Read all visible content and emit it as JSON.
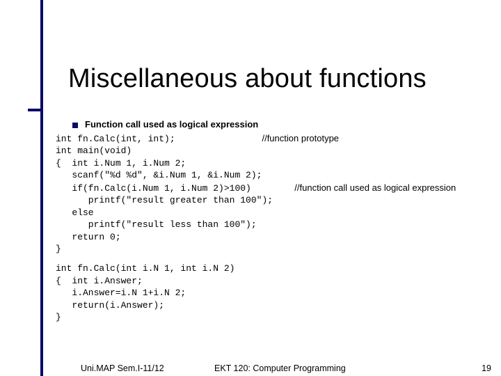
{
  "title": "Miscellaneous about functions",
  "bullet": "Function call used as logical expression",
  "code1": "int fn.Calc(int, int);",
  "comment1": "//function prototype",
  "code2": "int main(void)",
  "code3": "{  int i.Num 1, i.Num 2;",
  "code4": "   scanf(\"%d %d\", &i.Num 1, &i.Num 2);",
  "code5": "   if(fn.Calc(i.Num 1, i.Num 2)>100)",
  "comment2": "//function call used as logical expression",
  "code6": "      printf(\"result greater than 100\");",
  "code7": "   else",
  "code8": "      printf(\"result less than 100\");",
  "code9": "   return 0;",
  "code10": "}",
  "code11": "int fn.Calc(int i.N 1, int i.N 2)",
  "code12": "{  int i.Answer;",
  "code13": "   i.Answer=i.N 1+i.N 2;",
  "code14": "   return(i.Answer);",
  "code15": "}",
  "footer": {
    "left": "Uni.MAP Sem.I-11/12",
    "center": "EKT 120: Computer Programming",
    "right": "19"
  }
}
